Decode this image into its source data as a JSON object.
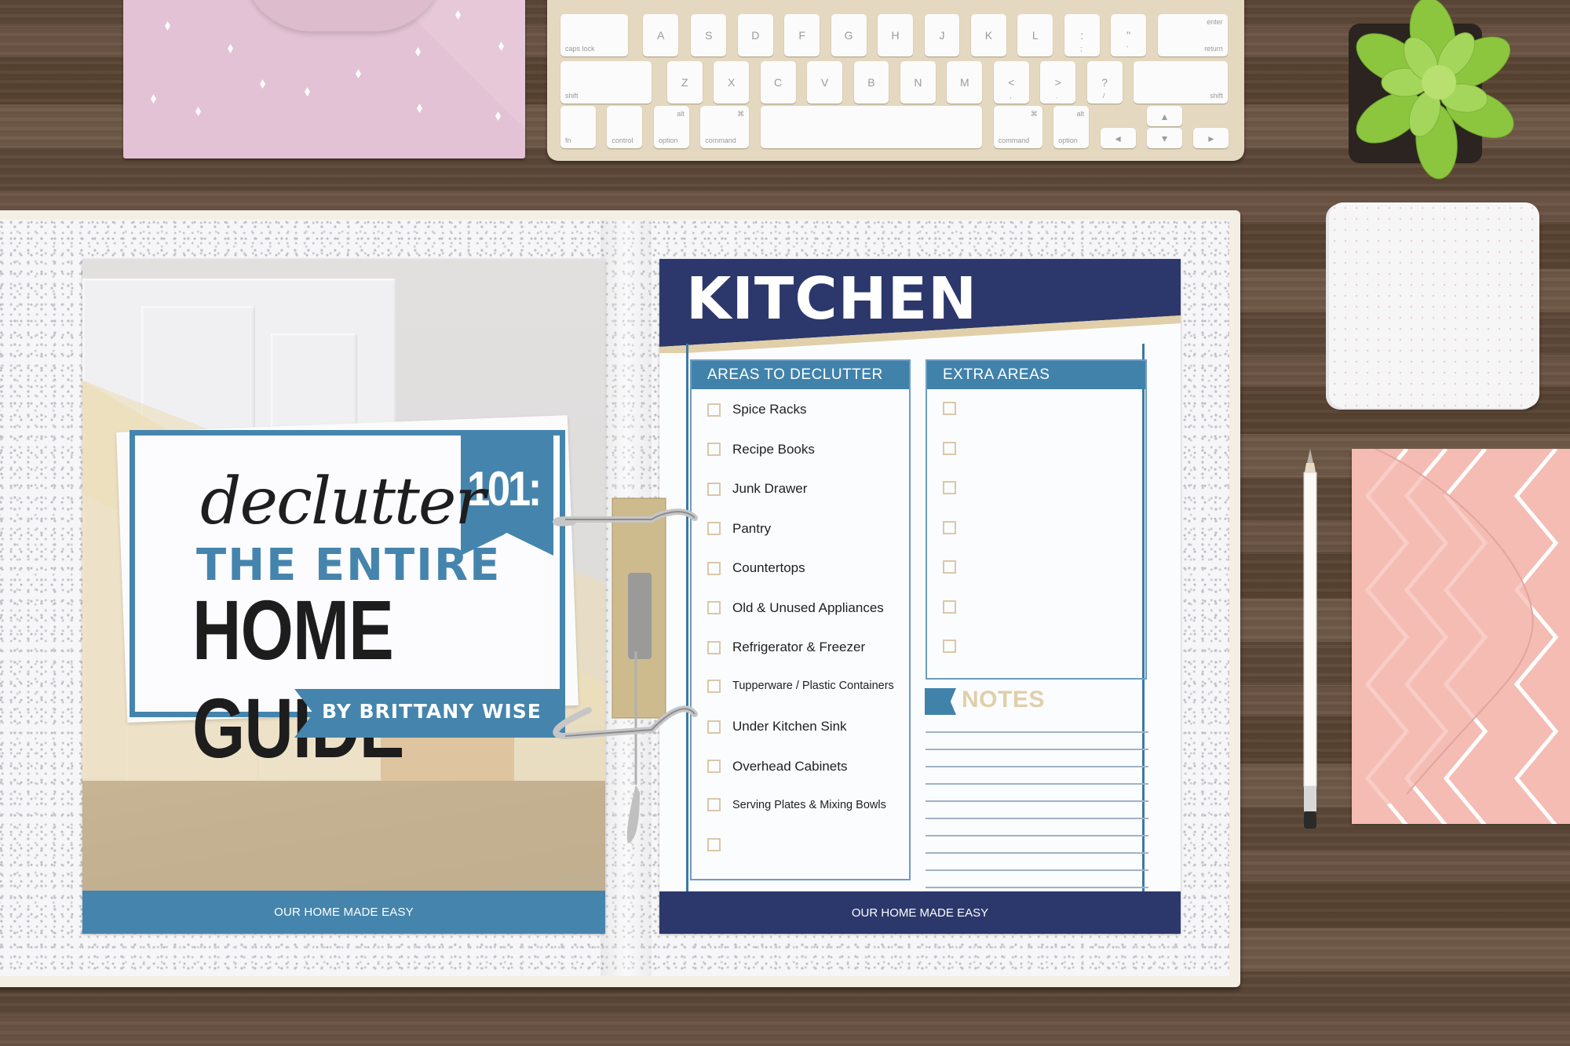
{
  "scene": {
    "description": "Flat-lay desk with open binder showing declutter printables"
  },
  "colors": {
    "navy": "#2c386b",
    "steel_blue": "#4182aa",
    "tan": "#e0cfa9",
    "envelope_lilac": "#e2c2d4",
    "envelope_pink": "#f4bcb3",
    "plant_green": "#8cc63f"
  },
  "keyboard": {
    "rows": [
      {
        "keys": [
          {
            "main": "",
            "bottom": "caps lock"
          },
          {
            "main": "A"
          },
          {
            "main": "S"
          },
          {
            "main": "D"
          },
          {
            "main": "F"
          },
          {
            "main": "G"
          },
          {
            "main": "H"
          },
          {
            "main": "J"
          },
          {
            "main": "K"
          },
          {
            "main": "L"
          },
          {
            "main": ":",
            "sub": ";"
          },
          {
            "main": "\"",
            "sub": "'"
          },
          {
            "main": "",
            "top": "enter",
            "bottom": "return"
          }
        ]
      },
      {
        "keys": [
          {
            "main": "",
            "bottom": "shift"
          },
          {
            "main": "Z"
          },
          {
            "main": "X"
          },
          {
            "main": "C"
          },
          {
            "main": "V"
          },
          {
            "main": "B"
          },
          {
            "main": "N"
          },
          {
            "main": "M"
          },
          {
            "main": "<",
            "sub": ","
          },
          {
            "main": ">",
            "sub": "."
          },
          {
            "main": "?",
            "sub": "/"
          },
          {
            "main": "",
            "bottom": "shift"
          }
        ]
      },
      {
        "keys": [
          {
            "main": "",
            "bottom": "fn"
          },
          {
            "main": "",
            "bottom": "control"
          },
          {
            "main": "",
            "top": "alt",
            "bottom": "option"
          },
          {
            "main": "",
            "top": "⌘",
            "bottom": "command"
          },
          {
            "main": ""
          },
          {
            "main": "",
            "top": "⌘",
            "bottom": "command"
          },
          {
            "main": "",
            "top": "alt",
            "bottom": "option"
          },
          {
            "main": "◂"
          },
          {
            "main": "▴"
          },
          {
            "main": "▾"
          },
          {
            "main": "▸"
          }
        ]
      }
    ]
  },
  "cover": {
    "script_word": "declutter",
    "badge_number": "101:",
    "line_2": "THE ENTIRE",
    "line_3": "HOME GUIDE",
    "byline": "BY BRITTANY WISE",
    "footer": "OUR HOME MADE EASY"
  },
  "kitchen": {
    "title": "KITCHEN",
    "areas": {
      "heading": "AREAS TO DECLUTTER",
      "items": [
        {
          "label": "Spice Racks",
          "checked": false
        },
        {
          "label": "Recipe Books",
          "checked": false
        },
        {
          "label": "Junk Drawer",
          "checked": false
        },
        {
          "label": "Pantry",
          "checked": false
        },
        {
          "label": "Countertops",
          "checked": false
        },
        {
          "label": "Old & Unused Appliances",
          "checked": false
        },
        {
          "label": "Refrigerator & Freezer",
          "checked": false
        },
        {
          "label": "Tupperware / Plastic Containers",
          "checked": false
        },
        {
          "label": "Under Kitchen Sink",
          "checked": false
        },
        {
          "label": "Overhead Cabinets",
          "checked": false
        },
        {
          "label": "Serving Plates & Mixing Bowls",
          "checked": false
        },
        {
          "label": "",
          "checked": false
        }
      ]
    },
    "extra": {
      "heading": "EXTRA AREAS",
      "items": [
        {
          "label": "",
          "checked": false
        },
        {
          "label": "",
          "checked": false
        },
        {
          "label": "",
          "checked": false
        },
        {
          "label": "",
          "checked": false
        },
        {
          "label": "",
          "checked": false
        },
        {
          "label": "",
          "checked": false
        },
        {
          "label": "",
          "checked": false
        }
      ]
    },
    "notes": {
      "heading": "NOTES",
      "line_count": 10
    },
    "footer": "OUR HOME MADE EASY"
  }
}
